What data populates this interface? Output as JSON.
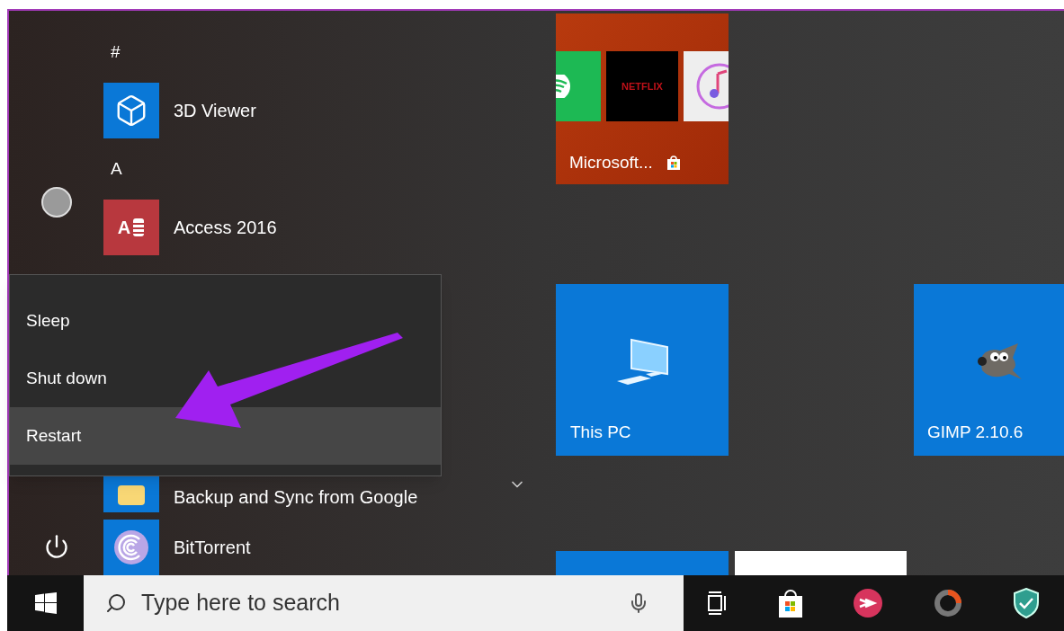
{
  "app_list": [
    {
      "kind": "header",
      "label": "#"
    },
    {
      "kind": "app",
      "label": "3D Viewer"
    },
    {
      "kind": "header",
      "label": "A"
    },
    {
      "kind": "app",
      "label": "Access 2016",
      "icon_text": "A"
    }
  ],
  "app_list_bottom": [
    {
      "kind": "app",
      "label": "Backup and Sync from Google"
    },
    {
      "kind": "app",
      "label": "BitTorrent"
    }
  ],
  "power_menu": [
    {
      "label": "Sleep",
      "selected": false
    },
    {
      "label": "Shut down",
      "selected": false
    },
    {
      "label": "Restart",
      "selected": true
    }
  ],
  "tiles": {
    "store": {
      "label": "Microsoft...",
      "netflix": "NETFLIX"
    },
    "this_pc": {
      "label": "This PC"
    },
    "gimp": {
      "label": "GIMP 2.10.6"
    }
  },
  "taskbar": {
    "search": {
      "placeholder": "Type here to search"
    }
  }
}
